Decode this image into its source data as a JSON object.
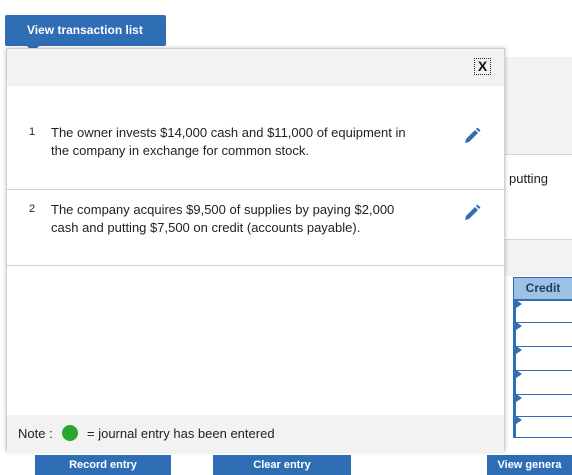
{
  "toolbar": {
    "view_transaction_list_label": "View transaction list"
  },
  "popup": {
    "close_label": "X",
    "transactions": [
      {
        "number": "1",
        "text": "The owner invests $14,000 cash and $11,000 of equipment in the company in exchange for common stock."
      },
      {
        "number": "2",
        "text": "The company acquires $9,500 of supplies by paying $2,000 cash and putting $7,500 on credit (accounts payable)."
      }
    ],
    "note": {
      "label": "Note :",
      "text": "= journal entry has been entered"
    }
  },
  "background": {
    "partial_text": "putting",
    "credit_header": "Credit",
    "buttons": {
      "record_entry": "Record entry",
      "clear_entry": "Clear entry",
      "view_general": "View genera"
    }
  },
  "colors": {
    "accent": "#2f6eb5",
    "entered_dot": "#2aa532",
    "panel_gray": "#f2f2f2"
  }
}
